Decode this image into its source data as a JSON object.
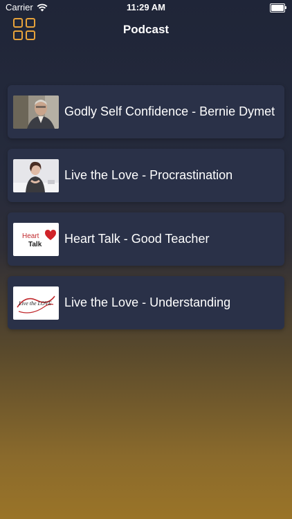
{
  "status_bar": {
    "carrier": "Carrier",
    "time": "11:29 AM"
  },
  "nav": {
    "title": "Podcast",
    "menu_icon": "grid-menu-icon",
    "accent_color": "#e8a33a"
  },
  "podcasts": [
    {
      "title": "Godly Self Confidence - Bernie Dymet",
      "thumbnail": "man-portrait"
    },
    {
      "title": "Live the Love - Procrastination",
      "thumbnail": "woman-desk"
    },
    {
      "title": "Heart Talk - Good Teacher",
      "thumbnail": "heart-talk-logo",
      "logo_text": [
        "Heart",
        "Talk"
      ]
    },
    {
      "title": "Live the Love - Understanding",
      "thumbnail": "live-the-love-logo",
      "logo_text": "Live the LOVE"
    }
  ]
}
